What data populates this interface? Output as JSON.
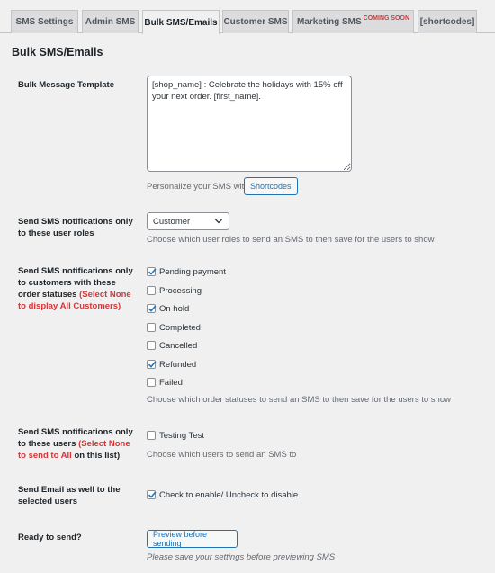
{
  "tabs": [
    {
      "label": "SMS Settings",
      "active": false
    },
    {
      "label": "Admin SMS",
      "active": false
    },
    {
      "label": "Bulk SMS/Emails",
      "active": true
    },
    {
      "label": "Customer SMS",
      "active": false
    },
    {
      "label": "Marketing SMS",
      "badge": "COMING SOON",
      "active": false
    },
    {
      "label": "[shortcodes]",
      "active": false
    }
  ],
  "page_title": "Bulk SMS/Emails",
  "template": {
    "label": "Bulk Message Template",
    "value": "[shop_name] : Celebrate the holidays with 15% off your next order. [first_name].",
    "help_text": "Personalize your SMS with",
    "shortcodes_button": "Shortcodes"
  },
  "user_roles": {
    "label": "Send SMS notifications only to these user roles",
    "selected": "Customer",
    "help_text": "Choose which user roles to send an SMS to then save for the users to show"
  },
  "order_statuses": {
    "label_main": "Send SMS notifications only to customers with these order statuses",
    "label_red": "(Select None to display All Customers)",
    "options": [
      {
        "label": "Pending payment",
        "checked": true
      },
      {
        "label": "Processing",
        "checked": false
      },
      {
        "label": "On hold",
        "checked": true
      },
      {
        "label": "Completed",
        "checked": false
      },
      {
        "label": "Cancelled",
        "checked": false
      },
      {
        "label": "Refunded",
        "checked": true
      },
      {
        "label": "Failed",
        "checked": false
      }
    ],
    "help_text": "Choose which order statuses to send an SMS to then save for the users to show"
  },
  "users": {
    "label_main": "Send SMS notifications only to these users",
    "label_red": "(Select None to send to All",
    "label_tail": "on this list)",
    "options": [
      {
        "label": "Testing Test",
        "checked": false
      }
    ],
    "help_text": "Choose which users to send an SMS to"
  },
  "email": {
    "label": "Send Email as well to the selected users",
    "option_label": "Check to enable/ Uncheck to disable",
    "checked": true
  },
  "ready": {
    "label": "Ready to send?",
    "preview_button": "Preview before sending",
    "note": "Please save your settings before previewing SMS"
  },
  "colors": {
    "accent": "#2271b1",
    "warning_red": "#d63638",
    "background": "#f0f0f1"
  }
}
